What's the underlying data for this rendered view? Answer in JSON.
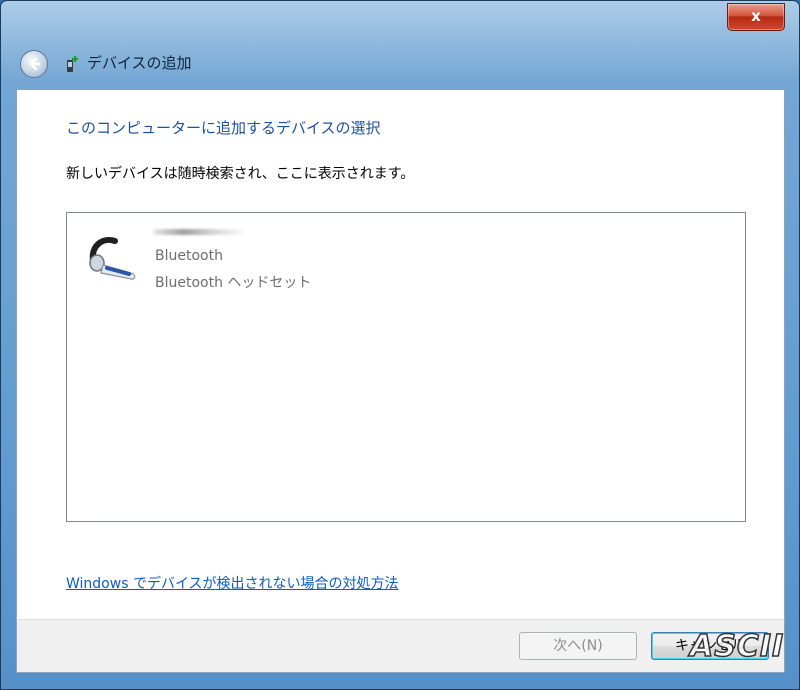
{
  "window": {
    "title": "デバイスの追加",
    "close_label": "x"
  },
  "content": {
    "heading": "このコンピューターに追加するデバイスの選択",
    "instruction": "新しいデバイスは随時検索され、ここに表示されます。",
    "devices": [
      {
        "icon": "bluetooth-headset-icon",
        "line1": "Bluetooth",
        "line2": "Bluetooth ヘッドセット"
      }
    ],
    "help_link": "Windows でデバイスが検出されない場合の対処方法"
  },
  "footer": {
    "next_label": "次へ(N)",
    "cancel_label": "キャンセル"
  },
  "watermark": "ASCII",
  "colors": {
    "heading": "#1e4f9c",
    "link": "#0b5dc4",
    "disabled_text": "#8d8d8d"
  }
}
